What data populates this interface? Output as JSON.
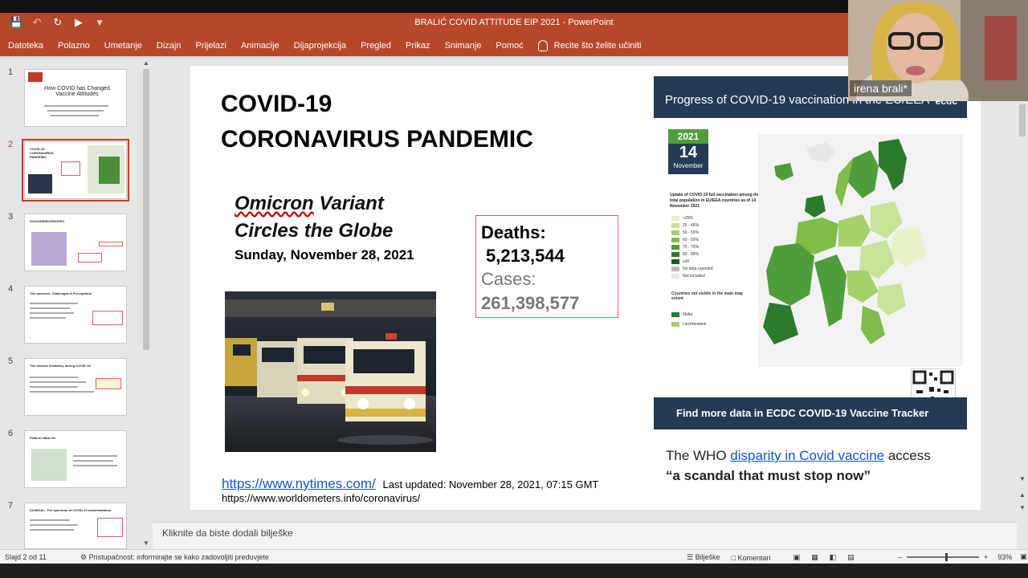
{
  "window": {
    "title": "BRALIĆ COVID ATTITUDE EIP 2021  -  PowerPoint"
  },
  "menu": {
    "items": [
      "Datoteka",
      "Polazno",
      "Umetanje",
      "Dizajn",
      "Prijelazi",
      "Animacije",
      "Dijaprojekcija",
      "Pregled",
      "Prikaz",
      "Snimanje",
      "Pomoć"
    ],
    "tell_me": "Recite što želite učiniti"
  },
  "webcam": {
    "name": "irena brali*"
  },
  "thumbnails": [
    {
      "num": "1",
      "title": "How COVID has Changed Vaccine Attitudes"
    },
    {
      "num": "2",
      "title": "COVID-19 CORONAVIRUS PANDEMIC"
    },
    {
      "num": "3",
      "title": "SOCIODEMOGRAPHIC"
    },
    {
      "num": "4",
      "title": "The vaccines: Challenges & Perceptions"
    },
    {
      "num": "5",
      "title": "The vaccine hesitancy during COVID-19"
    },
    {
      "num": "6",
      "title": "PUBLIC HEALTH"
    },
    {
      "num": "7",
      "title": "CLINICAL: The spectrum of COVID-19 manifestations"
    }
  ],
  "slide": {
    "title_line1": "COVID-19",
    "title_line2": "CORONAVIRUS PANDEMIC",
    "subtitle_line1_a": "Omicron",
    "subtitle_line1_b": " Variant",
    "subtitle_line2": "Circles the Globe",
    "date": "Sunday, November 28, 2021",
    "deaths_label": "Deaths:",
    "deaths_value": "5,213,544",
    "cases_label": "Cases:",
    "cases_value": "261,398,577",
    "link_nyt": "https://www.nytimes.com/",
    "updated": "Last updated: November 28, 2021, 07:15 GMT",
    "link_worldometers": "https://www.worldometers.info/coronavirus/",
    "ecdc_header": "Progress of COVID-19 vaccination in the EU/EEA",
    "ecdc_logo": "ecdc",
    "cal_year": "2021",
    "cal_day": "14",
    "cal_month": "November",
    "legend_title": "Uptake of COVID-19 full vaccination among the total population in EU/EEA countries as of 14 November 2021",
    "legend": [
      {
        "label": "<25%",
        "color": "#e8f2c8"
      },
      {
        "label": "25 - 49%",
        "color": "#c8e29a"
      },
      {
        "label": "50 - 59%",
        "color": "#a6d06a"
      },
      {
        "label": "60 - 69%",
        "color": "#7fbc48"
      },
      {
        "label": "70 - 79%",
        "color": "#4f9d3a"
      },
      {
        "label": "80 - 89%",
        "color": "#2b7a2e"
      },
      {
        "label": "≥90",
        "color": "#145a22"
      },
      {
        "label": "No data reported",
        "color": "#bbbbbb"
      },
      {
        "label": "Not included",
        "color": "#e6e6e6"
      }
    ],
    "not_visible_title": "Countries not visible in the main map extent",
    "not_visible": [
      {
        "label": "Malta",
        "color": "#2b7a2e"
      },
      {
        "label": "Liechtenstein",
        "color": "#a6d06a"
      }
    ],
    "ecdc_footer": "Find more data in ECDC COVID-19 Vaccine Tracker",
    "who_line1_a": "The WHO ",
    "who_line1_link": "disparity in Covid vaccine",
    "who_line1_b": " access",
    "who_line2": "“a scandal that must stop now”"
  },
  "notes_placeholder": "Kliknite da biste dodali bilješke",
  "status": {
    "slide_info": "Slajd 2 od 11",
    "accessibility": "Pristupačnost: informirajte se kako zadovoljiti preduvjete",
    "notes_btn": "Bilješke",
    "comments_btn": "Komentari",
    "zoom": "93%"
  }
}
